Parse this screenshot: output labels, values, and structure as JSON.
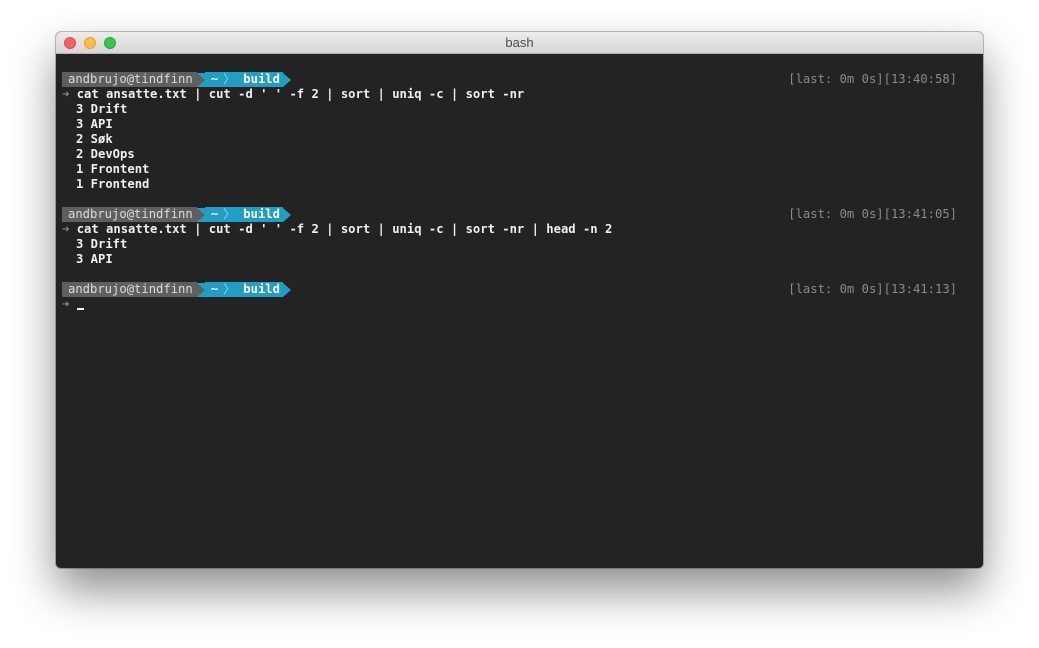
{
  "window": {
    "title": "bash"
  },
  "sessions": [
    {
      "prompt": {
        "user": "andbrujo@tindfinn",
        "dir1": "~",
        "dir_sep": "〉",
        "dir2": "build"
      },
      "last": "[last: 0m 0s][13:40:58]",
      "arrow": "➜",
      "command": "cat ansatte.txt | cut -d ' ' -f 2 | sort | uniq -c | sort -nr",
      "output": [
        "3 Drift",
        "3 API",
        "2 Søk",
        "2 DevOps",
        "1 Frontent",
        "1 Frontend"
      ]
    },
    {
      "prompt": {
        "user": "andbrujo@tindfinn",
        "dir1": "~",
        "dir_sep": "〉",
        "dir2": "build"
      },
      "last": "[last: 0m 0s][13:41:05]",
      "arrow": "➜",
      "command": "cat ansatte.txt | cut -d ' ' -f 2 | sort | uniq -c | sort -nr | head -n 2",
      "output": [
        "3 Drift",
        "3 API"
      ]
    },
    {
      "prompt": {
        "user": "andbrujo@tindfinn",
        "dir1": "~",
        "dir_sep": "〉",
        "dir2": "build"
      },
      "last": "[last: 0m 0s][13:41:13]",
      "arrow": "➜",
      "command": "",
      "output": []
    }
  ],
  "colors": {
    "terminal_bg": "#232323",
    "prompt_user_bg": "#5f5f5f",
    "prompt_dir_bg": "#1f9ec6",
    "text": "#f0f0f0",
    "dim_text": "#8a8a8a"
  }
}
